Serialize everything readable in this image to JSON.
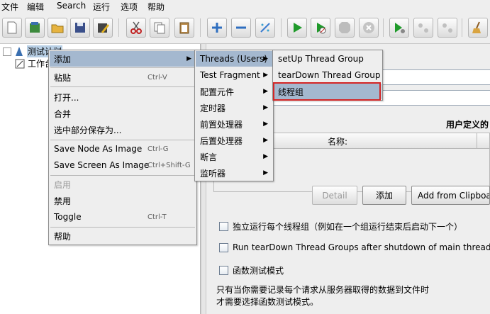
{
  "menubar": [
    "文件",
    "编辑",
    "Search",
    "运行",
    "选项",
    "帮助"
  ],
  "tree": {
    "root_label": "测试计划",
    "child_label": "工作台"
  },
  "context_menu": {
    "items": [
      {
        "label": "添加",
        "shortcut": "",
        "submenu": true,
        "highlight": true,
        "disabled": false
      },
      {
        "label": "粘贴",
        "shortcut": "Ctrl-V",
        "submenu": false,
        "highlight": false,
        "disabled": false
      },
      {
        "label": "打开...",
        "shortcut": "",
        "submenu": false,
        "highlight": false,
        "disabled": false
      },
      {
        "label": "合并",
        "shortcut": "",
        "submenu": false,
        "highlight": false,
        "disabled": false
      },
      {
        "label": "选中部分保存为...",
        "shortcut": "",
        "submenu": false,
        "highlight": false,
        "disabled": false
      },
      {
        "label": "Save Node As Image",
        "shortcut": "Ctrl-G",
        "submenu": false,
        "highlight": false,
        "disabled": false
      },
      {
        "label": "Save Screen As Image",
        "shortcut": "Ctrl+Shift-G",
        "submenu": false,
        "highlight": false,
        "disabled": false
      },
      {
        "label": "启用",
        "shortcut": "",
        "submenu": false,
        "highlight": false,
        "disabled": true
      },
      {
        "label": "禁用",
        "shortcut": "",
        "submenu": false,
        "highlight": false,
        "disabled": false
      },
      {
        "label": "Toggle",
        "shortcut": "Ctrl-T",
        "submenu": false,
        "highlight": false,
        "disabled": false
      },
      {
        "label": "帮助",
        "shortcut": "",
        "submenu": false,
        "highlight": false,
        "disabled": false
      }
    ]
  },
  "add_submenu": {
    "items": [
      {
        "label": "Threads (Users)",
        "highlight": true
      },
      {
        "label": "Test Fragment",
        "highlight": false
      },
      {
        "label": "配置元件",
        "highlight": false
      },
      {
        "label": "定时器",
        "highlight": false
      },
      {
        "label": "前置处理器",
        "highlight": false
      },
      {
        "label": "后置处理器",
        "highlight": false
      },
      {
        "label": "断言",
        "highlight": false
      },
      {
        "label": "监听器",
        "highlight": false
      }
    ]
  },
  "threads_submenu": {
    "items": [
      {
        "label": "setUp Thread Group",
        "highlight": false
      },
      {
        "label": "tearDown Thread Group",
        "highlight": false
      },
      {
        "label": "线程组",
        "highlight": true
      }
    ]
  },
  "panel": {
    "udv_title": "用户定义的",
    "name_column": "名称:",
    "btn_detail": "Detail",
    "btn_add": "添加",
    "btn_add_clipboard": "Add from Clipboa",
    "chk_independent": "独立运行每个线程组（例如在一个组运行结束后启动下一个）",
    "chk_teardown": "Run tearDown Thread Groups after shutdown of main threads",
    "chk_functional": "函数测试模式",
    "note_line1": "只有当你需要记录每个请求从服务器取得的数据到文件时",
    "note_line2": "才需要选择函数测试模式。"
  },
  "colors": {
    "menu_highlight": "#a4b8cf",
    "red_outline": "#d42626",
    "tree_selection": "#b8cfe5"
  }
}
